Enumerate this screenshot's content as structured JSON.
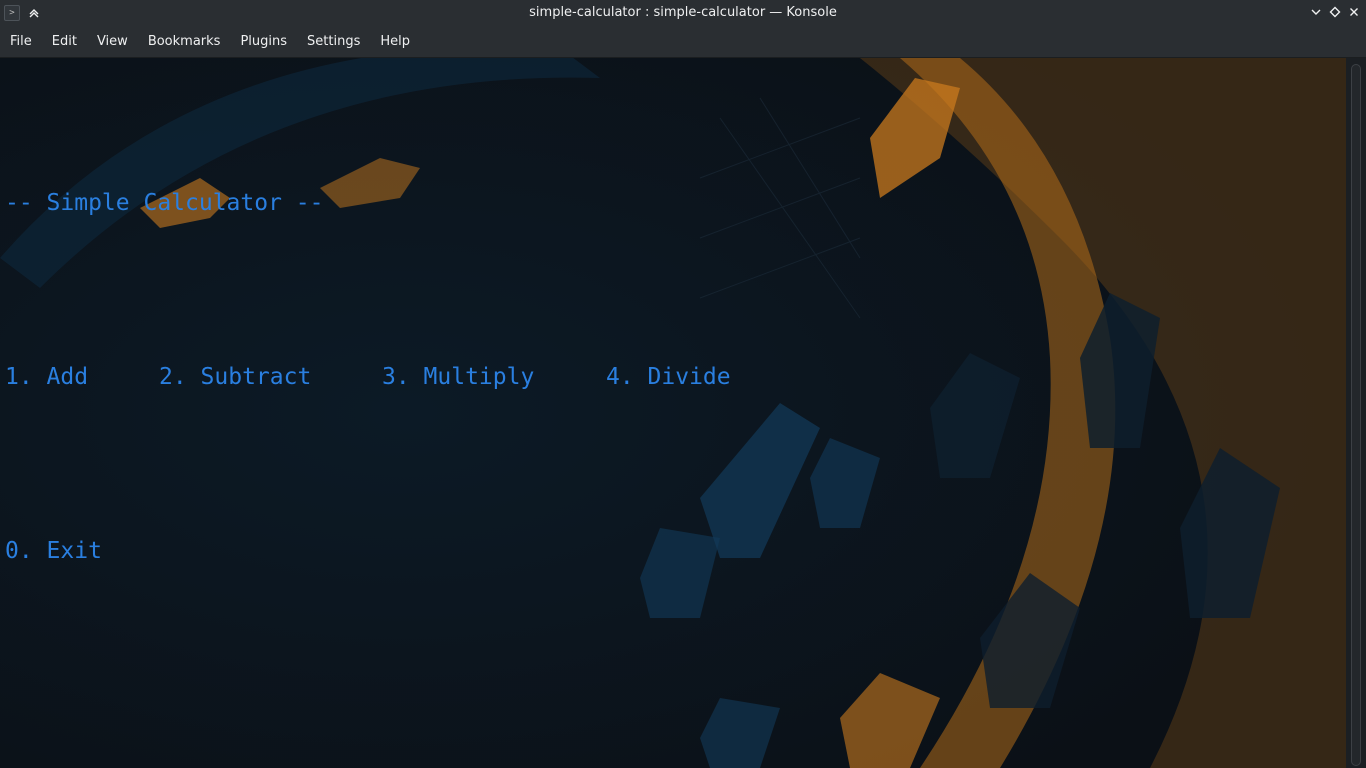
{
  "window": {
    "title": "simple-calculator : simple-calculator — Konsole",
    "app_icon": "terminal-icon",
    "left_buttons": [
      "terminal-icon",
      "keep-above-icon"
    ],
    "right_buttons": [
      "minimize-icon",
      "maximize-icon",
      "close-icon"
    ]
  },
  "menubar": {
    "items": [
      "File",
      "Edit",
      "View",
      "Bookmarks",
      "Plugins",
      "Settings",
      "Help"
    ]
  },
  "terminal": {
    "heading": "-- Simple Calculator --",
    "options": [
      "1. Add",
      "2. Subtract",
      "3. Multiply",
      "4. Divide"
    ],
    "exit_option": "0. Exit",
    "text_color": "#2a7fe0",
    "background_color": "#0e141b"
  },
  "colors": {
    "titlebar_bg": "#2a2e32",
    "wallpaper_orange": "#c97a1e",
    "wallpaper_blue": "#123a5a"
  }
}
